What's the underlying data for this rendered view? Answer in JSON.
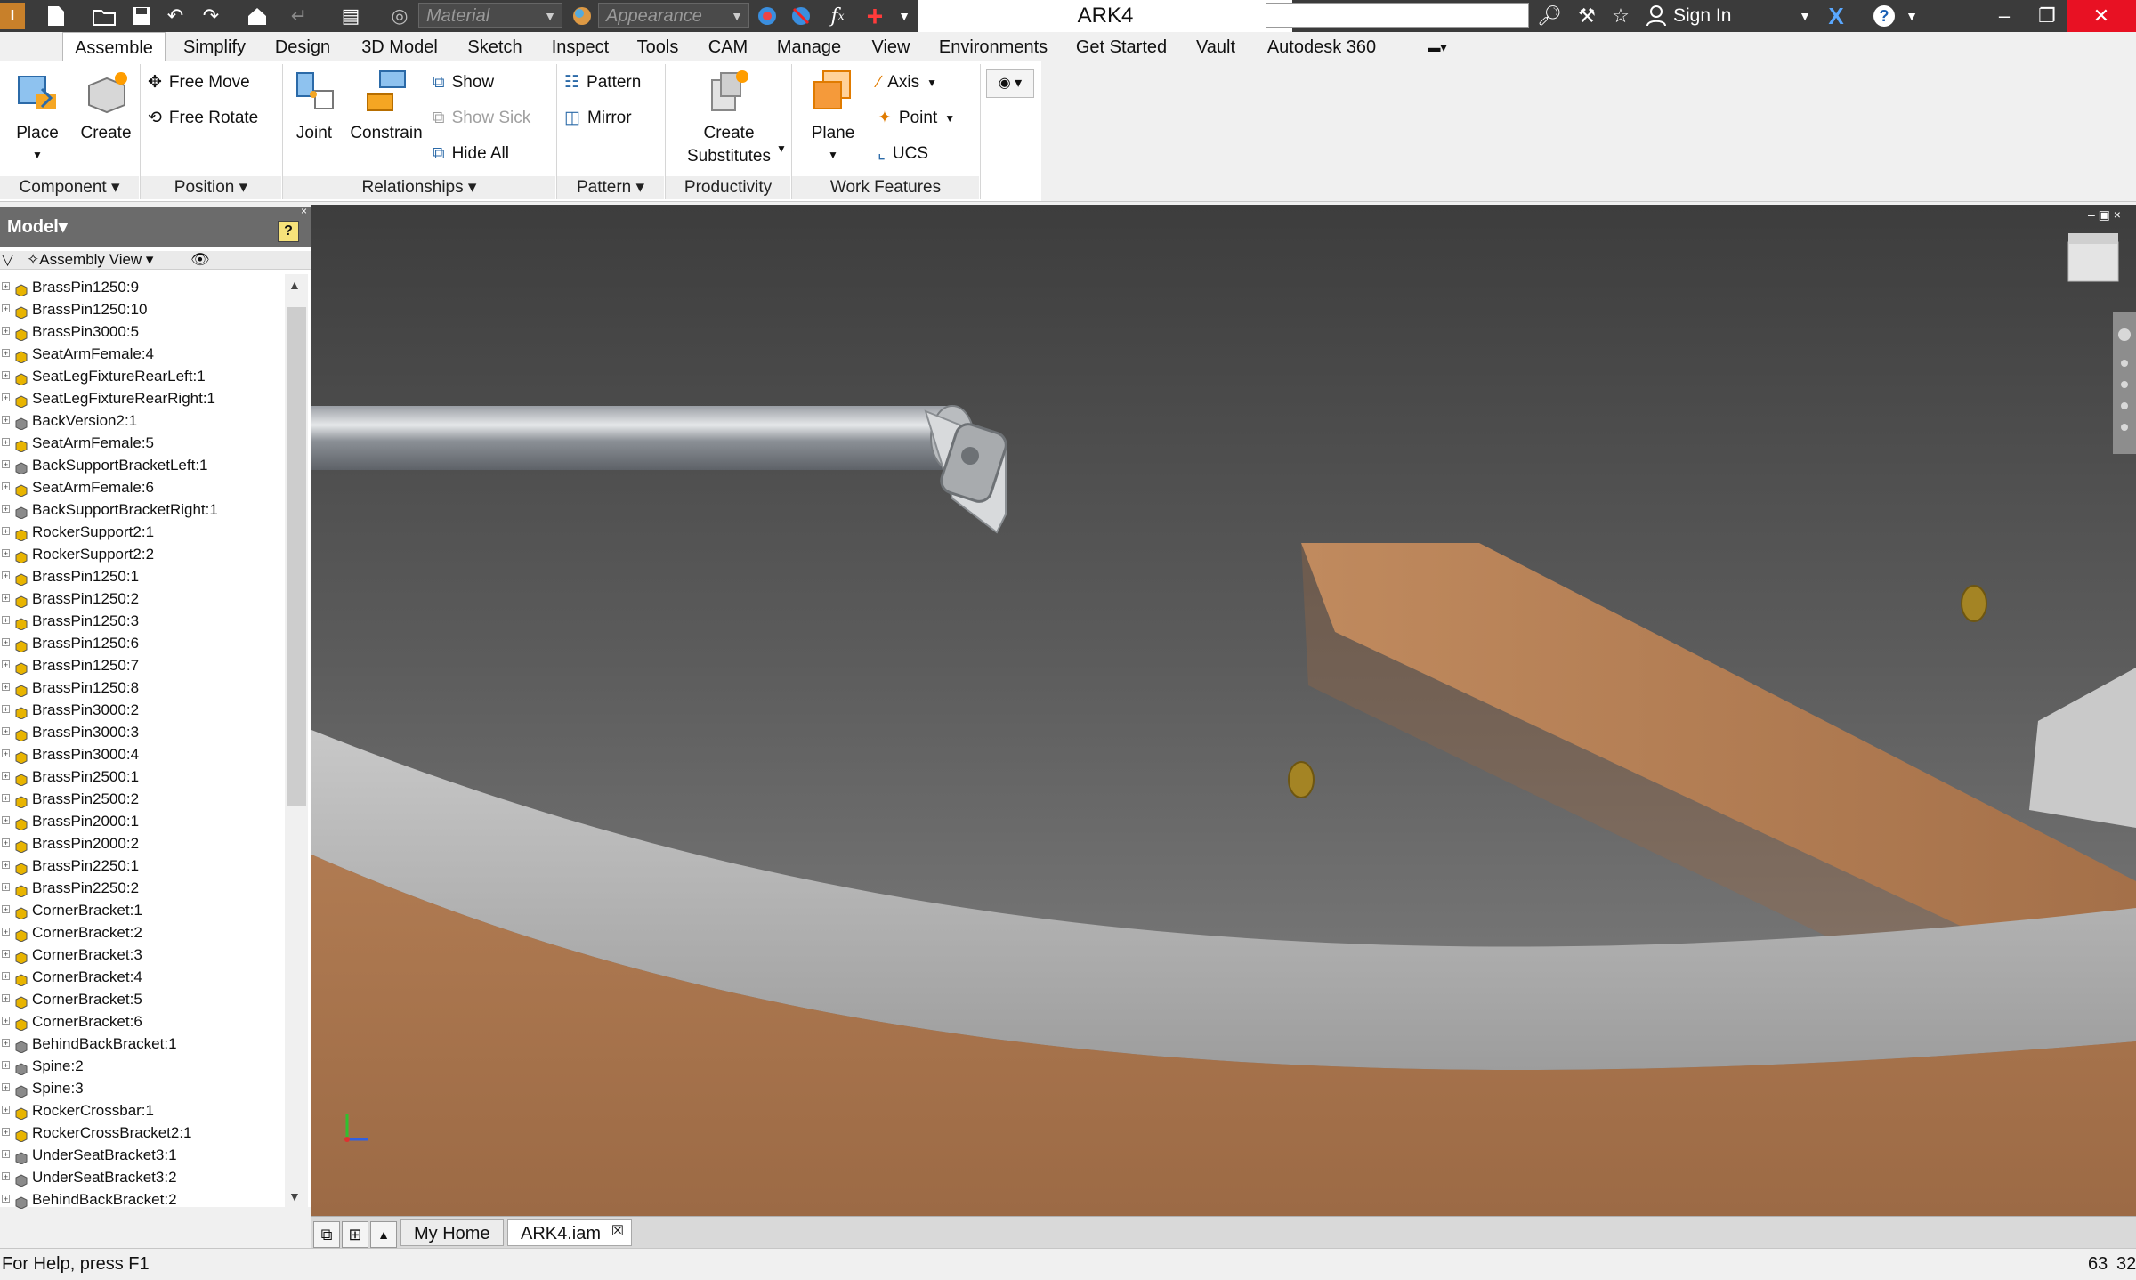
{
  "titlebar": {
    "material_placeholder": "Material",
    "appearance_placeholder": "Appearance",
    "document_title": "ARK4",
    "sign_in": "Sign In"
  },
  "tabs": [
    "Assemble",
    "Simplify",
    "Design",
    "3D Model",
    "Sketch",
    "Inspect",
    "Tools",
    "CAM",
    "Manage",
    "View",
    "Environments",
    "Get Started",
    "Vault",
    "Autodesk 360"
  ],
  "ribbon": {
    "component": {
      "place": "Place",
      "create": "Create",
      "panel": "Component"
    },
    "position": {
      "free_move": "Free Move",
      "free_rotate": "Free Rotate",
      "panel": "Position"
    },
    "relationships": {
      "joint": "Joint",
      "constrain": "Constrain",
      "show": "Show",
      "show_sick": "Show Sick",
      "hide_all": "Hide All",
      "panel": "Relationships"
    },
    "pattern": {
      "pattern": "Pattern",
      "mirror": "Mirror",
      "panel": "Pattern"
    },
    "productivity": {
      "create": "Create",
      "substitutes": "Substitutes",
      "panel": "Productivity"
    },
    "work_features": {
      "plane": "Plane",
      "axis": "Axis",
      "point": "Point",
      "ucs": "UCS",
      "panel": "Work Features"
    }
  },
  "browser": {
    "title": "Model",
    "view": "Assembly View",
    "items": [
      {
        "label": "BrassPin1250:9",
        "color": "#e8b400"
      },
      {
        "label": "BrassPin1250:10",
        "color": "#e8b400"
      },
      {
        "label": "BrassPin3000:5",
        "color": "#e8b400"
      },
      {
        "label": "SeatArmFemale:4",
        "color": "#e8b400"
      },
      {
        "label": "SeatLegFixtureRearLeft:1",
        "color": "#e8b400"
      },
      {
        "label": "SeatLegFixtureRearRight:1",
        "color": "#e8b400"
      },
      {
        "label": "BackVersion2:1",
        "color": "#8a8a8a"
      },
      {
        "label": "SeatArmFemale:5",
        "color": "#e8b400"
      },
      {
        "label": "BackSupportBracketLeft:1",
        "color": "#8a8a8a"
      },
      {
        "label": "SeatArmFemale:6",
        "color": "#e8b400"
      },
      {
        "label": "BackSupportBracketRight:1",
        "color": "#8a8a8a"
      },
      {
        "label": "RockerSupport2:1",
        "color": "#e8b400"
      },
      {
        "label": "RockerSupport2:2",
        "color": "#e8b400"
      },
      {
        "label": "BrassPin1250:1",
        "color": "#e8b400"
      },
      {
        "label": "BrassPin1250:2",
        "color": "#e8b400"
      },
      {
        "label": "BrassPin1250:3",
        "color": "#e8b400"
      },
      {
        "label": "BrassPin1250:6",
        "color": "#e8b400"
      },
      {
        "label": "BrassPin1250:7",
        "color": "#e8b400"
      },
      {
        "label": "BrassPin1250:8",
        "color": "#e8b400"
      },
      {
        "label": "BrassPin3000:2",
        "color": "#e8b400"
      },
      {
        "label": "BrassPin3000:3",
        "color": "#e8b400"
      },
      {
        "label": "BrassPin3000:4",
        "color": "#e8b400"
      },
      {
        "label": "BrassPin2500:1",
        "color": "#e8b400"
      },
      {
        "label": "BrassPin2500:2",
        "color": "#e8b400"
      },
      {
        "label": "BrassPin2000:1",
        "color": "#e8b400"
      },
      {
        "label": "BrassPin2000:2",
        "color": "#e8b400"
      },
      {
        "label": "BrassPin2250:1",
        "color": "#e8b400"
      },
      {
        "label": "BrassPin2250:2",
        "color": "#e8b400"
      },
      {
        "label": "CornerBracket:1",
        "color": "#e8b400"
      },
      {
        "label": "CornerBracket:2",
        "color": "#e8b400"
      },
      {
        "label": "CornerBracket:3",
        "color": "#e8b400"
      },
      {
        "label": "CornerBracket:4",
        "color": "#e8b400"
      },
      {
        "label": "CornerBracket:5",
        "color": "#e8b400"
      },
      {
        "label": "CornerBracket:6",
        "color": "#e8b400"
      },
      {
        "label": "BehindBackBracket:1",
        "color": "#8a8a8a"
      },
      {
        "label": "Spine:2",
        "color": "#8a8a8a"
      },
      {
        "label": "Spine:3",
        "color": "#8a8a8a"
      },
      {
        "label": "RockerCrossbar:1",
        "color": "#e8b400"
      },
      {
        "label": "RockerCrossBracket2:1",
        "color": "#e8b400"
      },
      {
        "label": "UnderSeatBracket3:1",
        "color": "#8a8a8a"
      },
      {
        "label": "UnderSeatBracket3:2",
        "color": "#8a8a8a"
      },
      {
        "label": "BehindBackBracket:2",
        "color": "#8a8a8a"
      }
    ]
  },
  "doc_tabs": {
    "home": "My Home",
    "file": "ARK4.iam"
  },
  "status": {
    "help": "For Help, press F1",
    "count_a": "63",
    "count_b": "32"
  }
}
